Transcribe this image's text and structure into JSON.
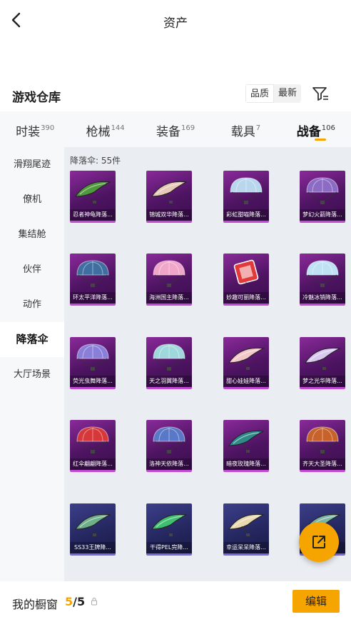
{
  "nav": {
    "title": "资产"
  },
  "header": {
    "title": "游戏仓库",
    "sort": [
      "品质",
      "最新"
    ]
  },
  "tabs": [
    {
      "label": "时装",
      "count": "390"
    },
    {
      "label": "枪械",
      "count": "144"
    },
    {
      "label": "装备",
      "count": "169"
    },
    {
      "label": "载具",
      "count": "7"
    },
    {
      "label": "战备",
      "count": "106",
      "active": true
    }
  ],
  "sidebar": [
    {
      "label": "滑翔尾迹"
    },
    {
      "label": "僚机"
    },
    {
      "label": "集结舱"
    },
    {
      "label": "伙伴"
    },
    {
      "label": "动作"
    },
    {
      "label": "降落伞",
      "active": true
    },
    {
      "label": "大厅场景"
    }
  ],
  "content": {
    "count_label": "降落伞: 55件",
    "items": [
      {
        "name": "忍者神龟降落...",
        "icon": "glider-icon",
        "color": "#4e9a3c"
      },
      {
        "name": "锦城双华降落...",
        "icon": "glider-icon",
        "color": "#e6c9b8"
      },
      {
        "name": "彩虹甜喵降落...",
        "icon": "parachute-icon",
        "color": "#b9d7ec"
      },
      {
        "name": "梦幻火箭降落...",
        "icon": "parachute-icon",
        "color": "#8b6bc4"
      },
      {
        "name": "环太平洋降落...",
        "icon": "parachute-icon",
        "color": "#3f6fa0"
      },
      {
        "name": "海洲国主降落...",
        "icon": "parachute-icon",
        "color": "#f0a6c8"
      },
      {
        "name": "妙趣可丽降落...",
        "icon": "box-icon",
        "color": "#e23a3a"
      },
      {
        "name": "冷魅冰销降落...",
        "icon": "parachute-icon",
        "color": "#bfe1f4"
      },
      {
        "name": "荧光虫舞降落...",
        "icon": "parachute-icon",
        "color": "#8a7fd8"
      },
      {
        "name": "天之羽翼降落...",
        "icon": "parachute-icon",
        "color": "#9fd8dc"
      },
      {
        "name": "甜心娃娃降落...",
        "icon": "glider-icon",
        "color": "#f2c8c8"
      },
      {
        "name": "梦之光华降落...",
        "icon": "glider-icon",
        "color": "#d9c8f0"
      },
      {
        "name": "红伞翩翩降落...",
        "icon": "parachute-icon",
        "color": "#d6383a"
      },
      {
        "name": "洛神天依降落...",
        "icon": "parachute-icon",
        "color": "#5a78c8"
      },
      {
        "name": "暗夜玫瑰降落...",
        "icon": "glider-icon",
        "color": "#2f8a8a"
      },
      {
        "name": "齐天大圣降落...",
        "icon": "parachute-icon",
        "color": "#c7632a"
      },
      {
        "name": "SS33王牌降...",
        "icon": "glider-icon",
        "color": "#6fb08a",
        "variant": "blue"
      },
      {
        "name": "干得PEL完降...",
        "icon": "glider-icon",
        "color": "#3fbf6f",
        "variant": "blue"
      },
      {
        "name": "幸运呆呆降落...",
        "icon": "glider-icon",
        "color": "#e8d9b0",
        "variant": "blue"
      },
      {
        "name": "",
        "icon": "glider-icon",
        "color": "#7fb8a8",
        "variant": "blue"
      }
    ]
  },
  "fab": {
    "icon": "share-icon"
  },
  "bottom": {
    "showcase_label": "我的橱窗",
    "current": "5",
    "total": "/5",
    "edit_label": "编辑"
  },
  "colors": {
    "accent": "#f6a400"
  }
}
